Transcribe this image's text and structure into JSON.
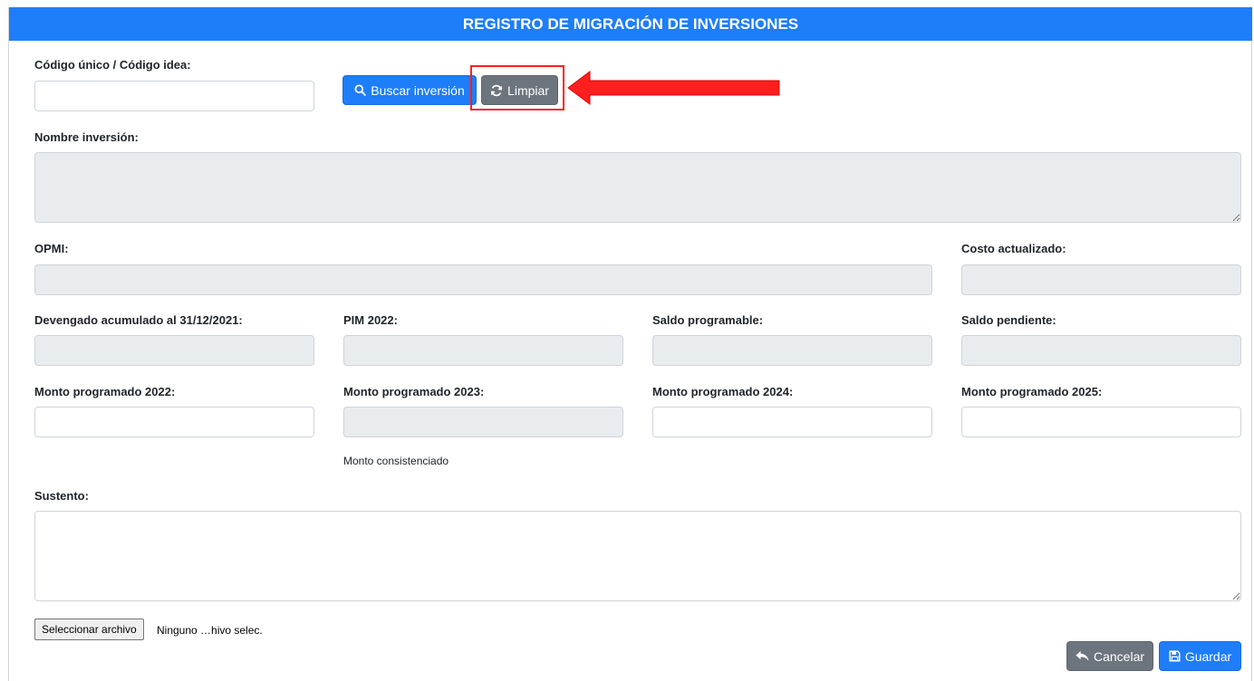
{
  "header": {
    "title": "REGISTRO DE MIGRACIÓN DE INVERSIONES"
  },
  "search": {
    "code_label": "Código único / Código idea:",
    "code_value": "",
    "search_button": "Buscar inversión",
    "clear_button": "Limpiar"
  },
  "fields": {
    "nombre_label": "Nombre inversión:",
    "opmi_label": "OPMI:",
    "costo_label": "Costo actualizado:",
    "devengado_label": "Devengado acumulado al 31/12/2021:",
    "pim_label": "PIM 2022:",
    "saldo_prog_label": "Saldo programable:",
    "saldo_pend_label": "Saldo pendiente:",
    "monto2022_label": "Monto programado 2022:",
    "monto2023_label": "Monto programado 2023:",
    "monto2024_label": "Monto programado 2024:",
    "monto2025_label": "Monto programado 2025:",
    "monto2023_note": "Monto consistenciado",
    "sustento_label": "Sustento:"
  },
  "file": {
    "button_label": "Seleccionar archivo",
    "status": "Ninguno …hivo selec."
  },
  "actions": {
    "cancel": "Cancelar",
    "save": "Guardar"
  },
  "colors": {
    "primary": "#1e7df8",
    "secondary": "#6c757d",
    "highlight": "#ff1f1f",
    "readonly": "#e9ecef"
  }
}
